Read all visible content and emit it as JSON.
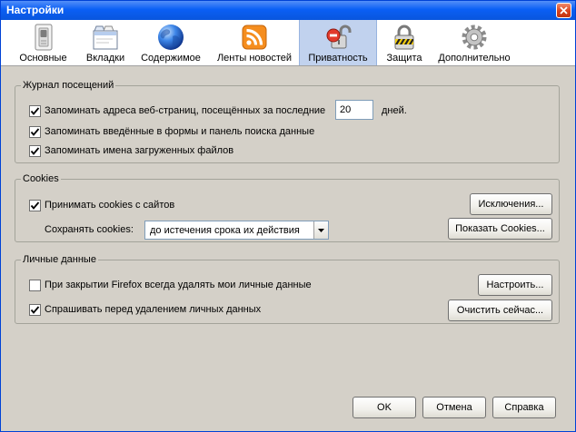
{
  "window": {
    "title": "Настройки"
  },
  "toolbar": {
    "tabs": [
      {
        "label": "Основные",
        "icon": "general-icon",
        "selected": false
      },
      {
        "label": "Вкладки",
        "icon": "tabs-icon",
        "selected": false
      },
      {
        "label": "Содержимое",
        "icon": "content-icon",
        "selected": false
      },
      {
        "label": "Ленты новостей",
        "icon": "feeds-icon",
        "selected": false
      },
      {
        "label": "Приватность",
        "icon": "privacy-icon",
        "selected": true
      },
      {
        "label": "Защита",
        "icon": "security-icon",
        "selected": false
      },
      {
        "label": "Дополнительно",
        "icon": "advanced-icon",
        "selected": false
      }
    ]
  },
  "history": {
    "legend": "Журнал посещений",
    "remember_pages": {
      "label": "Запоминать адреса веб-страниц, посещённых за последние",
      "checked": true,
      "days_value": "20",
      "days_suffix": "дней."
    },
    "remember_forms": {
      "label": "Запоминать введённые в формы и панель поиска данные",
      "checked": true
    },
    "remember_downloads": {
      "label": "Запоминать имена загруженных файлов",
      "checked": true
    }
  },
  "cookies": {
    "legend": "Cookies",
    "accept": {
      "label": "Принимать cookies с сайтов",
      "checked": true
    },
    "exceptions_label": "Исключения...",
    "keep_label": "Сохранять cookies:",
    "keep_value": "до истечения срока их действия",
    "show_label": "Показать Cookies..."
  },
  "private_data": {
    "legend": "Личные данные",
    "clear_on_close": {
      "label": "При закрытии Firefox всегда удалять мои личные данные",
      "checked": false
    },
    "settings_label": "Настроить...",
    "ask_before": {
      "label": "Спрашивать перед удалением личных данных",
      "checked": true
    },
    "clear_now_label": "Очистить сейчас..."
  },
  "footer": {
    "ok_label": "OK",
    "cancel_label": "Отмена",
    "help_label": "Справка"
  },
  "colors": {
    "titlebar": "#0a5ff5",
    "selected_tab": "#c1d2ee",
    "dialog_bg": "#d4d0c8"
  }
}
